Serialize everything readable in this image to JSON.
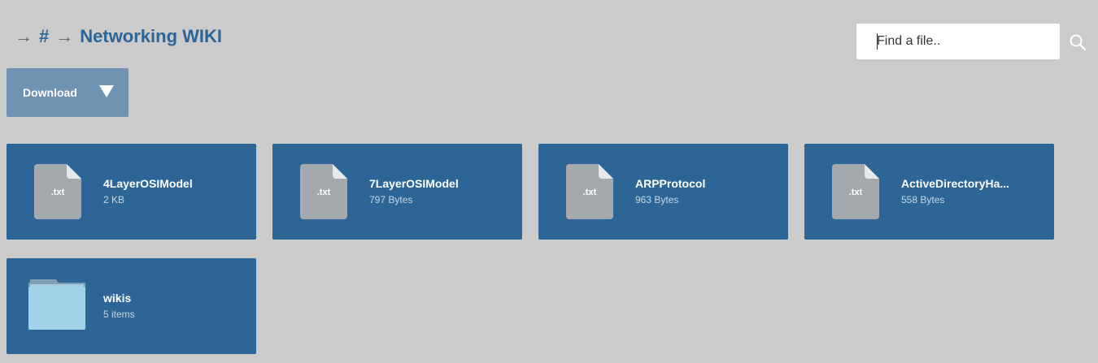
{
  "breadcrumb": {
    "root": "#",
    "current": "Networking WIKI"
  },
  "search": {
    "placeholder": "Find a file..",
    "icon": "search-icon"
  },
  "download": {
    "label": "Download"
  },
  "files": [
    {
      "name": "4LayerOSIModel",
      "meta": "2 KB",
      "ext": ".txt",
      "type": "file"
    },
    {
      "name": "7LayerOSIModel",
      "meta": "797 Bytes",
      "ext": ".txt",
      "type": "file"
    },
    {
      "name": "ARPProtocol",
      "meta": "963 Bytes",
      "ext": ".txt",
      "type": "file"
    },
    {
      "name": "ActiveDirectoryHa...",
      "meta": "558 Bytes",
      "ext": ".txt",
      "type": "file"
    },
    {
      "name": "wikis",
      "meta": "5 items",
      "type": "folder"
    }
  ],
  "colors": {
    "background": "#cbcbcb",
    "tile": "#2c6596",
    "download_button": "#6f93b2",
    "file_icon": "#a5a9ae",
    "folder_icon": "#a3d3e8",
    "breadcrumb_text": "#2c6596"
  }
}
